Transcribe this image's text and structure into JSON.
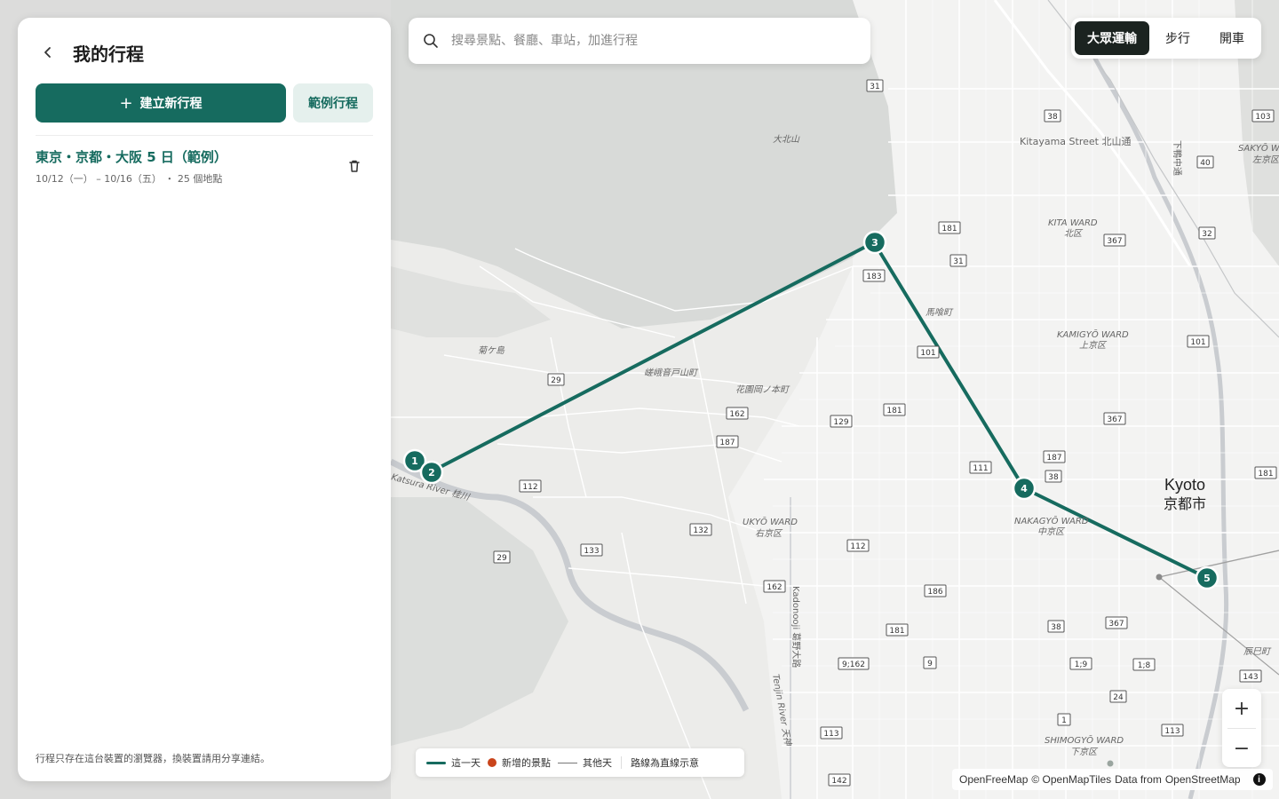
{
  "panel": {
    "title": "我的行程",
    "new_trip_label": "建立新行程",
    "sample_trip_label": "範例行程",
    "trips": [
      {
        "title": "東京・京都・大阪 5 日（範例）",
        "dates": "10/12（一） – 10/16（五）",
        "places": "・ 25 個地點"
      }
    ],
    "footer": "行程只存在這台裝置的瀏覽器，換裝置請用分享連結。"
  },
  "search": {
    "placeholder": "搜尋景點、餐廳、車站，加進行程"
  },
  "mode": {
    "options": [
      "大眾運輸",
      "步行",
      "開車"
    ],
    "active": "大眾運輸"
  },
  "zoom": {
    "in_label": "+",
    "out_label": "−"
  },
  "legend": {
    "this_day": "這一天",
    "new_spot": "新增的景點",
    "other_days": "其他天",
    "straight_line": "路線為直線示意"
  },
  "attribution": {
    "openfreemap": "OpenFreeMap",
    "tiles": "© OpenMapTiles",
    "data_from": "Data from",
    "osm": "OpenStreetMap"
  },
  "map": {
    "route_color": "#166b5f",
    "new_spot_color": "#c9441b",
    "pins": [
      "1",
      "2",
      "3",
      "4",
      "5"
    ],
    "city": {
      "name_en": "Kyoto",
      "name_local": "京都市"
    },
    "places": [
      "大北山",
      "Kitayama Street 北山通",
      "KITA WARD",
      "北区",
      "馬喰町",
      "KAMIGYŌ WARD",
      "上京区",
      "菊ケ島",
      "嵯峨音戸山町",
      "花園岡ノ本町",
      "UKYŌ WARD",
      "右京区",
      "NAKAGYŌ WARD",
      "中京区",
      "SHIMOGYŌ WARD",
      "下京区",
      "SAKYŌ WARD",
      "左京区",
      "Kadonooji 葛野大路",
      "Tenjin River 天神",
      "Katsura River 桂川",
      "辰巳町",
      "下鴨中通"
    ],
    "roads": [
      "31",
      "38",
      "103",
      "40",
      "181",
      "367",
      "32",
      "31",
      "183",
      "101",
      "367",
      "187",
      "38",
      "181",
      "111",
      "129",
      "181",
      "162",
      "187",
      "29",
      "112",
      "132",
      "112",
      "133",
      "29",
      "162",
      "186",
      "181",
      "9;162",
      "9",
      "1;9",
      "1;8",
      "143",
      "367",
      "38",
      "24",
      "1",
      "113",
      "113",
      "142",
      "9",
      "101"
    ]
  }
}
